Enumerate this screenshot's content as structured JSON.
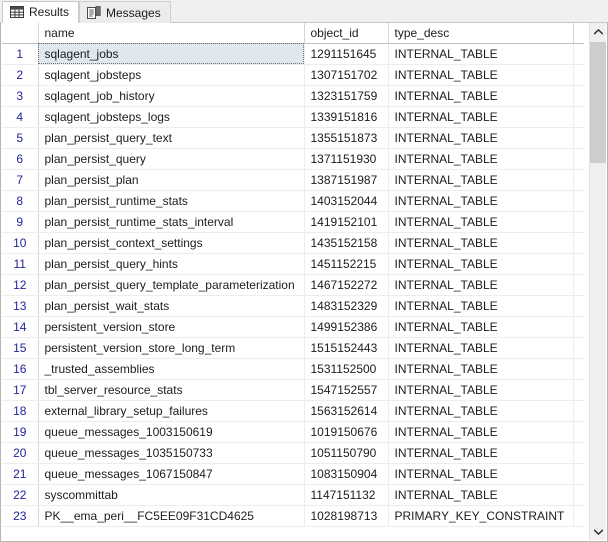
{
  "tabs": [
    {
      "label": "Results",
      "icon": "grid-icon",
      "active": true
    },
    {
      "label": "Messages",
      "icon": "document-icon",
      "active": false
    }
  ],
  "grid": {
    "row_number_header": "",
    "columns": [
      {
        "key": "name",
        "label": "name"
      },
      {
        "key": "object_id",
        "label": "object_id"
      },
      {
        "key": "type_desc",
        "label": "type_desc"
      }
    ],
    "selected_row": 1,
    "rows": [
      {
        "n": "1",
        "name": "sqlagent_jobs",
        "object_id": "1291151645",
        "type_desc": "INTERNAL_TABLE"
      },
      {
        "n": "2",
        "name": "sqlagent_jobsteps",
        "object_id": "1307151702",
        "type_desc": "INTERNAL_TABLE"
      },
      {
        "n": "3",
        "name": "sqlagent_job_history",
        "object_id": "1323151759",
        "type_desc": "INTERNAL_TABLE"
      },
      {
        "n": "4",
        "name": "sqlagent_jobsteps_logs",
        "object_id": "1339151816",
        "type_desc": "INTERNAL_TABLE"
      },
      {
        "n": "5",
        "name": "plan_persist_query_text",
        "object_id": "1355151873",
        "type_desc": "INTERNAL_TABLE"
      },
      {
        "n": "6",
        "name": "plan_persist_query",
        "object_id": "1371151930",
        "type_desc": "INTERNAL_TABLE"
      },
      {
        "n": "7",
        "name": "plan_persist_plan",
        "object_id": "1387151987",
        "type_desc": "INTERNAL_TABLE"
      },
      {
        "n": "8",
        "name": "plan_persist_runtime_stats",
        "object_id": "1403152044",
        "type_desc": "INTERNAL_TABLE"
      },
      {
        "n": "9",
        "name": "plan_persist_runtime_stats_interval",
        "object_id": "1419152101",
        "type_desc": "INTERNAL_TABLE"
      },
      {
        "n": "10",
        "name": "plan_persist_context_settings",
        "object_id": "1435152158",
        "type_desc": "INTERNAL_TABLE"
      },
      {
        "n": "11",
        "name": "plan_persist_query_hints",
        "object_id": "1451152215",
        "type_desc": "INTERNAL_TABLE"
      },
      {
        "n": "12",
        "name": "plan_persist_query_template_parameterization",
        "object_id": "1467152272",
        "type_desc": "INTERNAL_TABLE"
      },
      {
        "n": "13",
        "name": "plan_persist_wait_stats",
        "object_id": "1483152329",
        "type_desc": "INTERNAL_TABLE"
      },
      {
        "n": "14",
        "name": "persistent_version_store",
        "object_id": "1499152386",
        "type_desc": "INTERNAL_TABLE"
      },
      {
        "n": "15",
        "name": "persistent_version_store_long_term",
        "object_id": "1515152443",
        "type_desc": "INTERNAL_TABLE"
      },
      {
        "n": "16",
        "name": "_trusted_assemblies",
        "object_id": "1531152500",
        "type_desc": "INTERNAL_TABLE"
      },
      {
        "n": "17",
        "name": "tbl_server_resource_stats",
        "object_id": "1547152557",
        "type_desc": "INTERNAL_TABLE"
      },
      {
        "n": "18",
        "name": "external_library_setup_failures",
        "object_id": "1563152614",
        "type_desc": "INTERNAL_TABLE"
      },
      {
        "n": "19",
        "name": "queue_messages_1003150619",
        "object_id": "1019150676",
        "type_desc": "INTERNAL_TABLE"
      },
      {
        "n": "20",
        "name": "queue_messages_1035150733",
        "object_id": "1051150790",
        "type_desc": "INTERNAL_TABLE"
      },
      {
        "n": "21",
        "name": "queue_messages_1067150847",
        "object_id": "1083150904",
        "type_desc": "INTERNAL_TABLE"
      },
      {
        "n": "22",
        "name": "syscommittab",
        "object_id": "1147151132",
        "type_desc": "INTERNAL_TABLE"
      },
      {
        "n": "23",
        "name": "PK__ema_peri__FC5EE09F31CD4625",
        "object_id": "1028198713",
        "type_desc": "PRIMARY_KEY_CONSTRAINT"
      }
    ]
  },
  "scrollbar": {
    "up_icon": "chevron-up-icon",
    "down_icon": "chevron-down-icon",
    "thumb_position_percent": 0,
    "thumb_size_percent": 25
  },
  "colors": {
    "row_number": "#23239c",
    "selected_row_bg": "#dfe7ef",
    "grid_line": "#ededed",
    "header_line": "#c0c0c0",
    "scrollbar_thumb": "#cdcdcd",
    "tabstrip_bg": "#f0f0f0"
  }
}
